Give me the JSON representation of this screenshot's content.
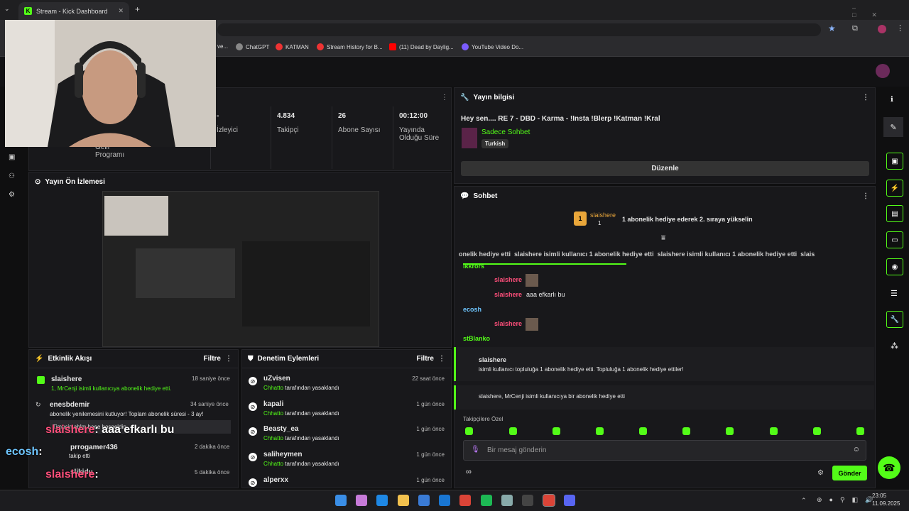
{
  "browser": {
    "tab_title": "Stream - Kick Dashboard",
    "bookmarks": [
      "ve...",
      "ChatGPT",
      "KATMAN",
      "Stream History for B...",
      "(11) Dead by Daylig...",
      "YouTube Video Do..."
    ]
  },
  "stats": [
    {
      "value": "-",
      "label": "İzleyici"
    },
    {
      "value": "4.834",
      "label": "Takipçi"
    },
    {
      "value": "26",
      "label": "Abone Sayısı"
    },
    {
      "value": "00:12:00",
      "label": "Yayında Olduğu Süre"
    }
  ],
  "stats_left_label": "Gelir Programı",
  "preview": {
    "title": "Yayın Ön İzlemesi"
  },
  "stream_info": {
    "title": "Yayın bilgisi",
    "stream_title": "Hey sen.... RE 7 - DBD - Karma - !Insta !Blerp !Katman !Kral",
    "category": "Sadece Sohbet",
    "language": "Turkish",
    "edit_button": "Düzenle"
  },
  "chat": {
    "title": "Sohbet",
    "top_gifter": "slaishere",
    "top_gifter_count": "1",
    "gift_note": "1 abonelik hediye ederek 2. sıraya yükselin",
    "ticker": "onelik hediye etti  slaishere isimli kullanıcı 1 abonelik hediye etti  slaishere isimli kullanıcı 1 abonelik hediye etti  slais",
    "messages": [
      {
        "user": "ikkrors",
        "text": ""
      },
      {
        "user": "slaishere",
        "text": ""
      },
      {
        "user": "slaishere",
        "text": "aaa efkarlı bu"
      },
      {
        "user": "ecosh",
        "text": ""
      },
      {
        "user": "slaishere",
        "text": ""
      },
      {
        "user": "stBlanko",
        "text": ""
      }
    ],
    "gift_user": "slaishere",
    "gift_text": "isimli kullanıcı topluluğa 1 abonelik hediye etti. Topluluğa 1 abonelik hediye ettiler!",
    "gift2_text": "slaishere, MrCenji isimli kullanıcıya bir abonelik hediye etti",
    "followers_special": "Takipçilere Özel",
    "placeholder": "Bir mesaj gönderin",
    "send": "Gönder",
    "infinity": "∞"
  },
  "activity": {
    "title": "Etkinlik Akışı",
    "filter": "Filtre",
    "items": [
      {
        "user": "slaishere",
        "time": "18 saniye önce",
        "text": "1, MrCenji isimli kullanıcıya abonelik hediye etti."
      },
      {
        "user": "enesbdemir",
        "time": "34 saniye önce",
        "text": "abonelik yenilemesini kutluyor! Toplam abonelik süresi - 3 ay!",
        "note": "Timuçin ablm beee hoşgeldin"
      },
      {
        "user": "prrogamer436",
        "time": "2 dakika önce",
        "text": "takip etti"
      },
      {
        "user": "slikidu",
        "time": "5 dakika önce",
        "text": "takip etti"
      }
    ]
  },
  "moderation": {
    "title": "Denetim Eylemleri",
    "filter": "Filtre",
    "by": "Chhatto",
    "action": "tarafından yasaklandı",
    "items": [
      {
        "user": "uZvisen",
        "time": "22 saat önce"
      },
      {
        "user": "kapali",
        "time": "1 gün önce"
      },
      {
        "user": "Beasty_ea",
        "time": "1 gün önce"
      },
      {
        "user": "saliheymen",
        "time": "1 gün önce"
      },
      {
        "user": "alperxx",
        "time": "1 gün önce"
      }
    ]
  },
  "overlay": {
    "l1_user": "slaishere",
    "l1_text": ": aaa efkarlı bu",
    "l2_user": "ecosh",
    "l2_text": ":",
    "l3_user": "slaishere",
    "l3_text": ":",
    "l4_user": "stBlanko",
    "l4_text": ":"
  },
  "clock": {
    "time": "23:05",
    "date": "11.09.2025"
  },
  "colors": {
    "accent": "#53fc18",
    "bg": "#18181b"
  }
}
